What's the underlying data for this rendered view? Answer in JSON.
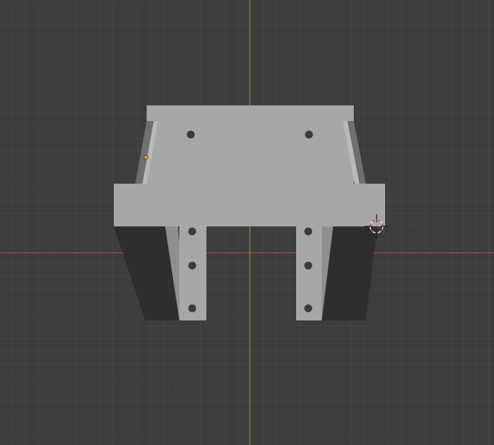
{
  "viewport": {
    "type": "3d-viewport",
    "background": "#3d3d3d",
    "x_axis_color": "#b04a4a",
    "y_axis_color": "#7a9a3a"
  },
  "model": {
    "face_color": "#a6a8a6",
    "shadow_color": "#2f2f2f",
    "side_color": "#8f918f",
    "hole_color": "#3b3b3b",
    "origin_color": "#f0a030"
  },
  "cursor": {
    "name": "3d-cursor",
    "ring_color_a": "#e0e0e0",
    "ring_color_b": "#d04040"
  }
}
